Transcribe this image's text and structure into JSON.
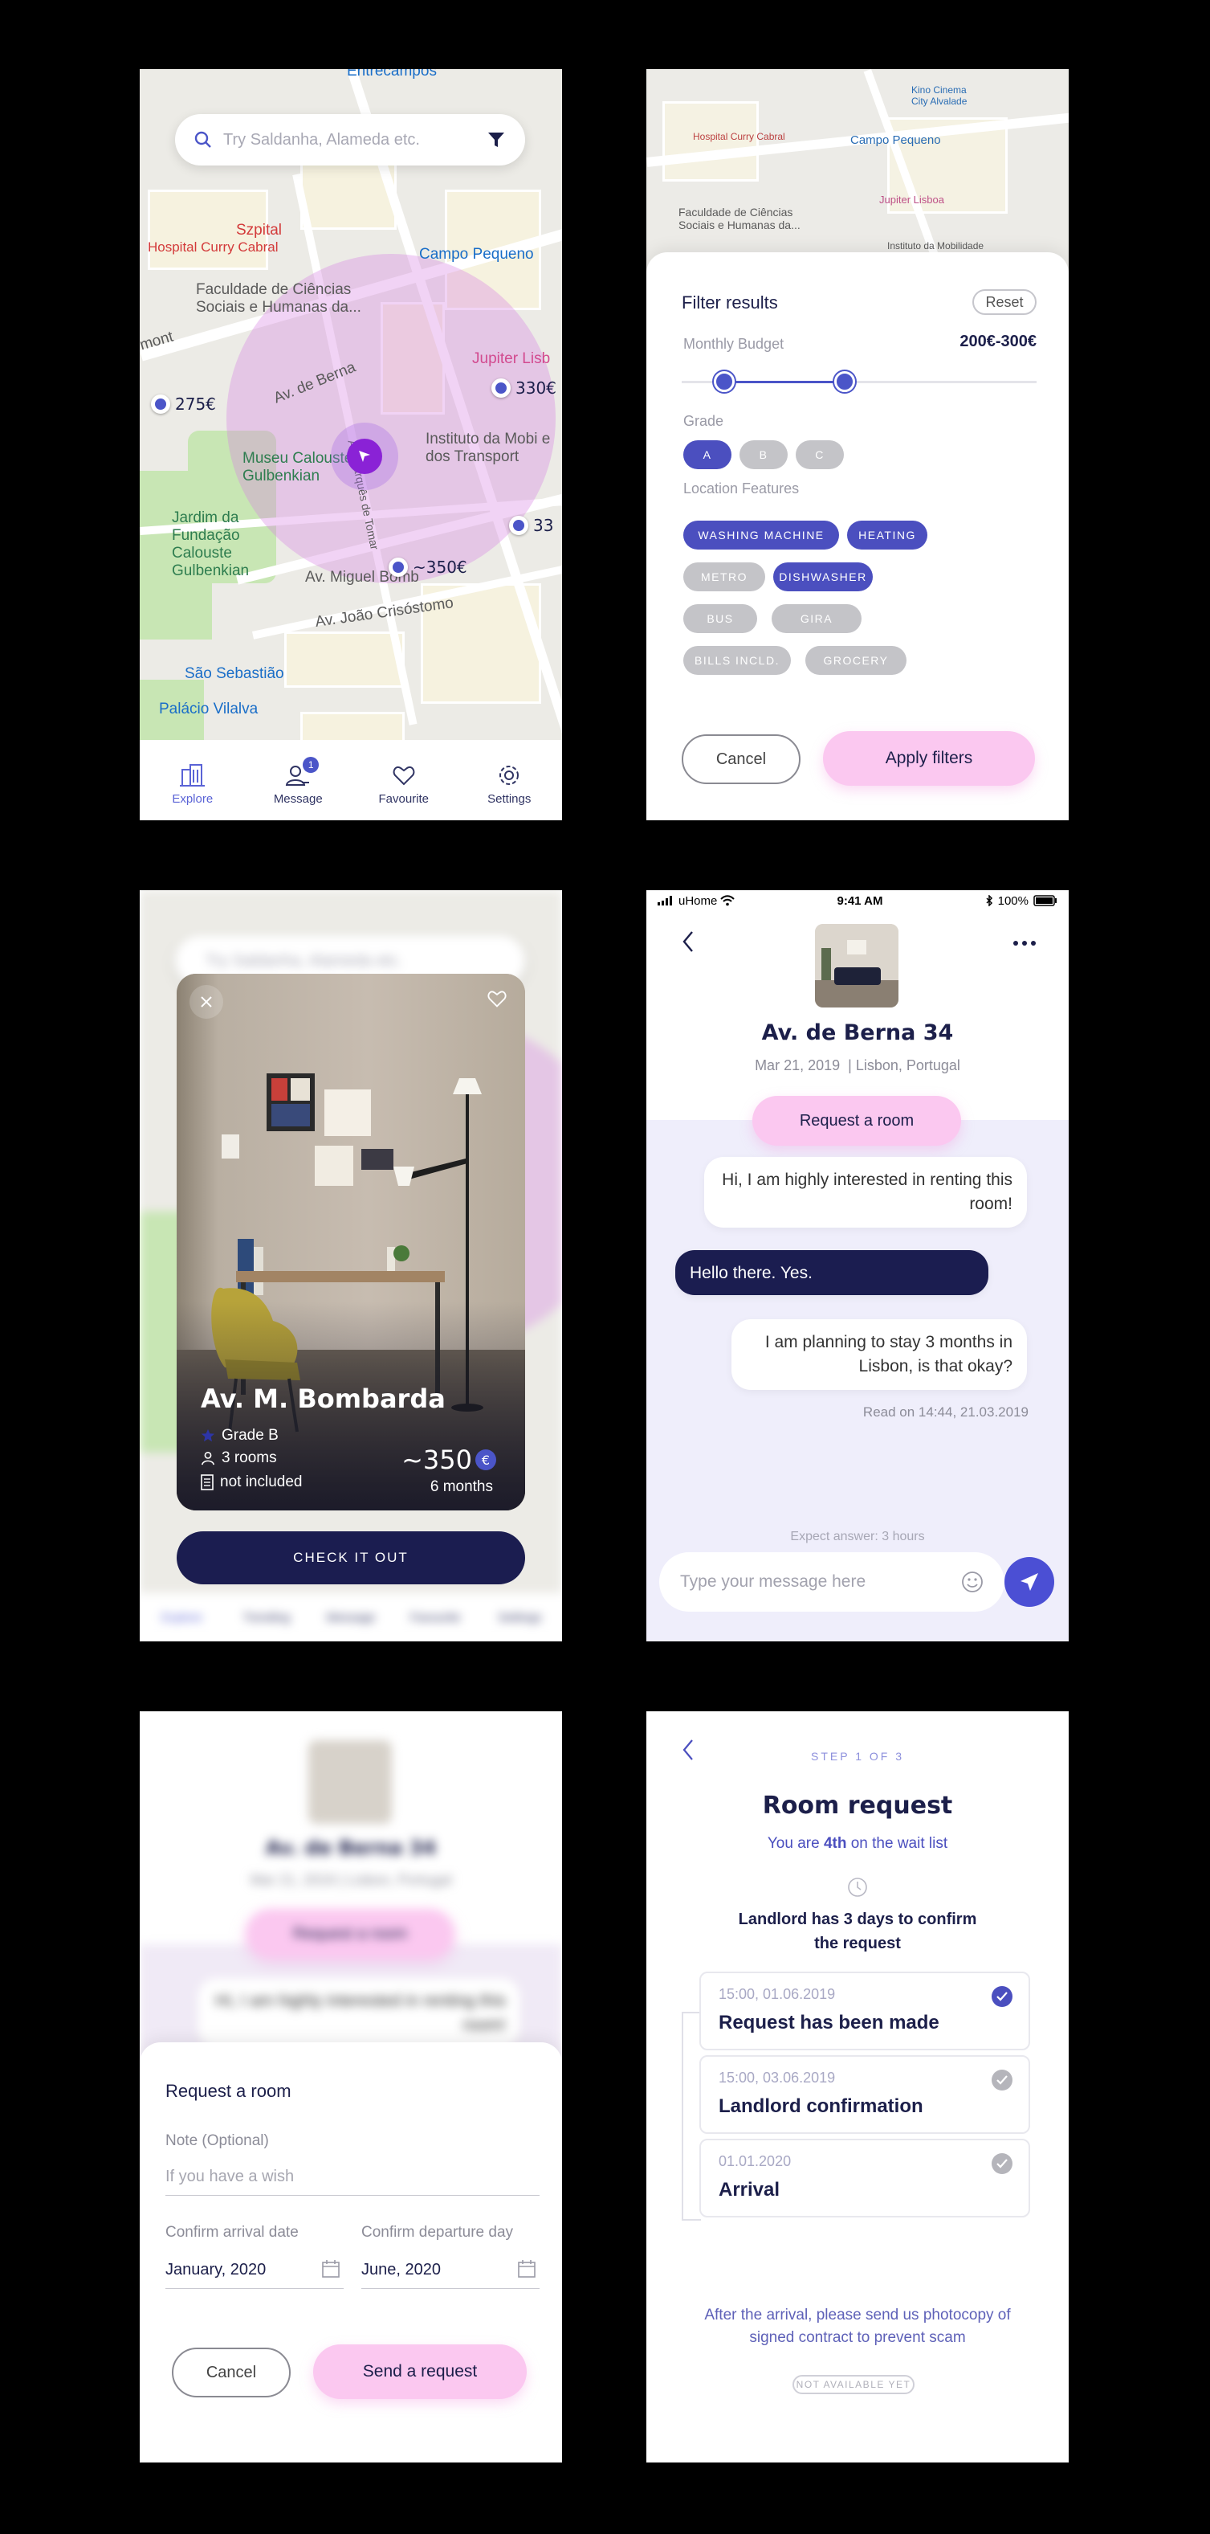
{
  "explore": {
    "search_placeholder": "Try Saldanha, Alameda etc.",
    "map_labels": [
      "Entrecampos",
      "Szpital",
      "Hospital Curry Cabral",
      "Faculdade de Ciências Sociais e Humanas da...",
      "Campo Pequeno",
      "Jupiter Lisb",
      "Av. de Berna",
      "Museu Calouste Gulbenkian",
      "Instituto da Mobi e dos Transport",
      "Jardim da Fundação Calouste Gulbenkian",
      "Av. Miguel Bomb",
      "Av. João Crisóstomo",
      "São Sebastião",
      "Palácio Vilalva",
      "Av. Marquês de Tomar",
      "mont"
    ],
    "prices": [
      "275€",
      "330€",
      "33",
      "~350€"
    ],
    "tabs": [
      {
        "label": "Explore",
        "icon": "building-icon"
      },
      {
        "label": "Message",
        "icon": "user-message-icon",
        "badge": "1"
      },
      {
        "label": "Favourite",
        "icon": "heart-icon"
      },
      {
        "label": "Settings",
        "icon": "gear-icon"
      }
    ]
  },
  "filter": {
    "title": "Filter results",
    "reset": "Reset",
    "budget_label": "Monthly Budget",
    "budget_value": "200€-300€",
    "budget_range": {
      "low_fraction": 0.12,
      "high_fraction": 0.46
    },
    "grade_label": "Grade",
    "grades": [
      {
        "label": "A",
        "selected": true
      },
      {
        "label": "B",
        "selected": false
      },
      {
        "label": "C",
        "selected": false
      }
    ],
    "features_label": "Location Features",
    "features": [
      {
        "label": "Washing machine",
        "selected": true
      },
      {
        "label": "Heating",
        "selected": true
      },
      {
        "label": "Metro",
        "selected": false
      },
      {
        "label": "Dishwasher",
        "selected": true
      },
      {
        "label": "Bus",
        "selected": false
      },
      {
        "label": "Gira",
        "selected": false
      },
      {
        "label": "Bills incld.",
        "selected": false
      },
      {
        "label": "Grocery",
        "selected": false
      }
    ],
    "cancel": "Cancel",
    "apply": "Apply filters",
    "map_labels": [
      "Kino Cinema City Alvalade",
      "Campo Pequeno",
      "Hospital Curry Cabral",
      "Faculdade de Ciências Sociais e Humanas da...",
      "Jupiter Lisboa",
      "Instituto da Mobilidade"
    ]
  },
  "room_card": {
    "name": "Av. M. Bombarda",
    "grade": "Grade B",
    "rooms": "3 rooms",
    "bills": "not included",
    "price": "~350",
    "currency": "€",
    "duration": "6 months",
    "cta": "CHECK IT OUT",
    "bg_search": "Try Saldanha, Alameda etc.",
    "bg_tabs": [
      "Explore",
      "Trending",
      "Message",
      "Favourite",
      "Settings"
    ]
  },
  "chat": {
    "status": {
      "carrier": "uHome",
      "time": "9:41 AM",
      "battery": "100%"
    },
    "title": "Av. de Berna 34",
    "date": "Mar 21, 2019",
    "location": "Lisbon, Portugal",
    "request_btn": "Request a room",
    "messages": [
      {
        "text": "Hi, I am highly interested in renting this room!",
        "from": "me"
      },
      {
        "text": "Hello there. Yes.",
        "from": "them"
      },
      {
        "text": "I am planning to stay 3 months in Lisbon, is that okay?",
        "from": "me"
      }
    ],
    "read_note": "Read on 14:44, 21.03.2019",
    "expect": "Expect answer: 3 hours",
    "input_placeholder": "Type your message here"
  },
  "request_form": {
    "bg_title": "Av. de Berna 34",
    "bg_sub": "Mar 21, 2019  | Lisbon, Portugal",
    "bg_btn": "Request a room",
    "bg_msg": "Hi, I am highly interested in renting this room!",
    "title": "Request a room",
    "note_label": "Note (Optional)",
    "note_placeholder": "If you have a wish",
    "arrival_label": "Confirm arrival date",
    "arrival_value": "January, 2020",
    "departure_label": "Confirm departure day",
    "departure_value": "June, 2020",
    "cancel": "Cancel",
    "send": "Send a request"
  },
  "status_page": {
    "step": "STEP 1 OF 3",
    "title": "Room request",
    "waitlist_pre": "You are ",
    "waitlist_num": "4th",
    "waitlist_post": " on the wait list",
    "landlord_note": "Landlord has 3 days to confirm the request",
    "steps": [
      {
        "date": "15:00, 01.06.2019",
        "title": "Request has been made",
        "done": true
      },
      {
        "date": "15:00, 03.06.2019",
        "title": "Landlord confirmation",
        "done": false
      },
      {
        "date": "01.01.2020",
        "title": "Arrival",
        "done": false
      }
    ],
    "footer": "After the arrival, please send us photocopy of signed contract to prevent scam",
    "tag": "NOT AVAILABLE YET"
  },
  "colors": {
    "accent": "#4b55c8",
    "navy": "#1b1d50",
    "pink": "#fbc8f0",
    "chat_bg": "#efeefb"
  }
}
